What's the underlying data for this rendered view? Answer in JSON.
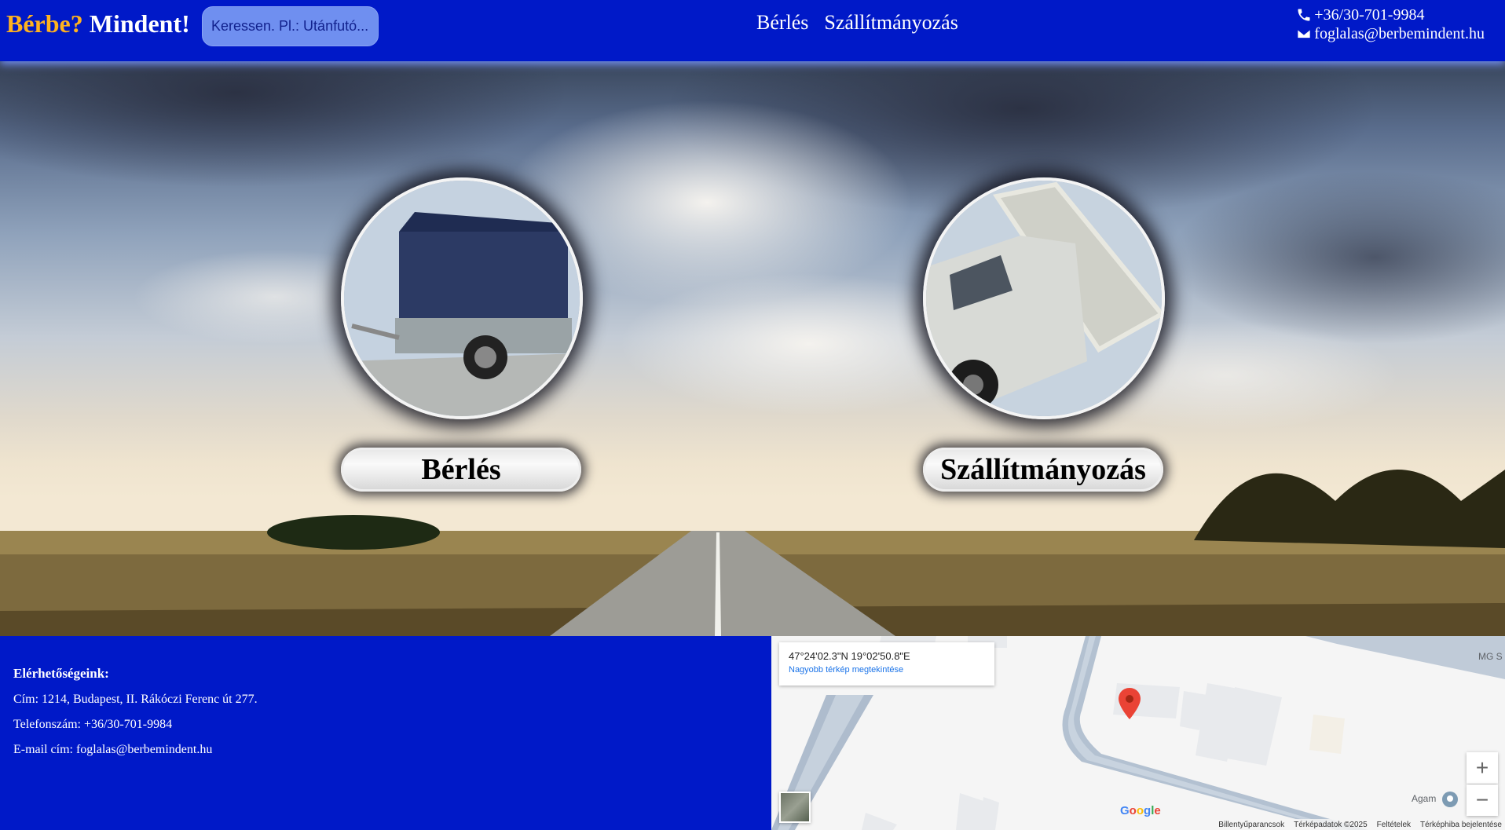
{
  "header": {
    "logo_part1": "Bérbe?",
    "logo_part2": " Mindent!",
    "search_placeholder": "Keressen. Pl.: Utánfutó...",
    "nav": [
      "Bérlés",
      "Szállítmányozás"
    ],
    "phone": "+36/30-701-9984",
    "email": "foglalas@berbemindent.hu"
  },
  "hero": {
    "cards": [
      {
        "label": "Bérlés",
        "image": "trailer-image"
      },
      {
        "label": "Szállítmányozás",
        "image": "tipper-truck-image"
      }
    ]
  },
  "footer": {
    "heading": "Elérhetőségeink:",
    "address": "Cím: 1214, Budapest, II. Rákóczi Ferenc út 277.",
    "phone": "Telefonszám: +36/30-701-9984",
    "email": "E-mail cím: foglalas@berbemindent.hu"
  },
  "map": {
    "coords": "47°24'02.3\"N 19°02'50.8\"E",
    "larger_map_link": "Nagyobb térkép megtekintése",
    "label_mg": "MG S",
    "label_agam": "Agam",
    "google_letters": [
      "G",
      "o",
      "o",
      "g",
      "l",
      "e"
    ],
    "zoom_in": "+",
    "zoom_out": "−",
    "attribution": [
      "Billentyűparancsok",
      "Térképadatok ©2025",
      "Feltételek",
      "Térképhiba bejelentése"
    ]
  },
  "colors": {
    "header_bg": "#0019c8",
    "logo_accent": "#ffb21f",
    "search_bg": "#6f8ff0",
    "map_link": "#1a73e8",
    "pin": "#ea4335"
  }
}
